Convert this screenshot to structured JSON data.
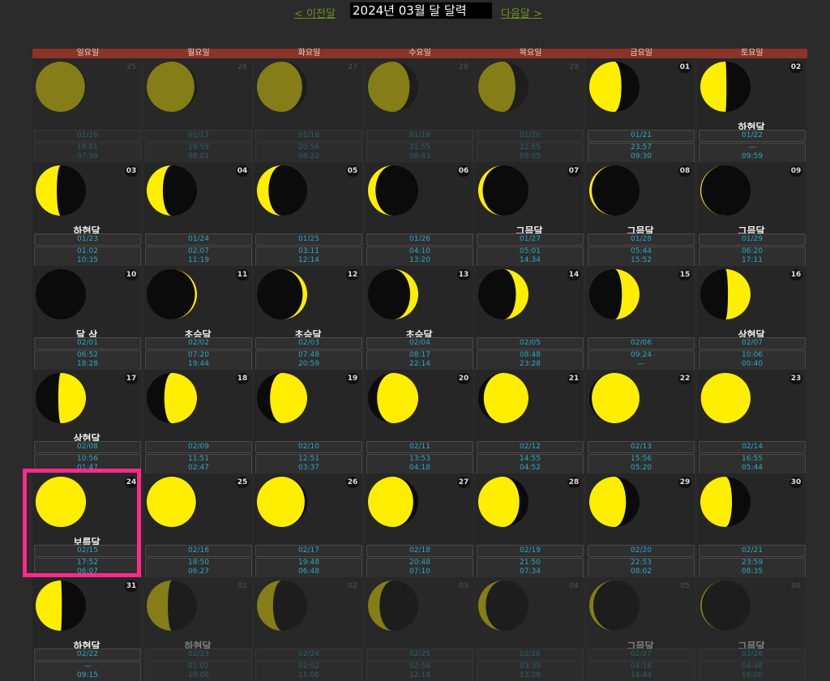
{
  "nav": {
    "prev_label": "< 이전달",
    "next_label": "다음달 >",
    "title": "2024년 03월 달 달력"
  },
  "weekdays": [
    "일요일",
    "월요일",
    "화요일",
    "수요일",
    "목요일",
    "금요일",
    "토요일"
  ],
  "colors": {
    "moon_lit": "#ffee00",
    "moon_dark": "#0b0b0b",
    "header_bg": "#8a3328",
    "accent_text": "#2da7c4",
    "highlight_border": "#ff2a8a"
  },
  "cells": [
    {
      "day": "25",
      "current": false,
      "phase": "",
      "lunar": "01/16",
      "rise": "19:01",
      "set": "07:39",
      "illum": 0.98,
      "waxing": false
    },
    {
      "day": "26",
      "current": false,
      "phase": "",
      "lunar": "01/17",
      "rise": "19:59",
      "set": "08:01",
      "illum": 0.95,
      "waxing": false
    },
    {
      "day": "27",
      "current": false,
      "phase": "",
      "lunar": "01/18",
      "rise": "20:56",
      "set": "08:22",
      "illum": 0.9,
      "waxing": false
    },
    {
      "day": "28",
      "current": false,
      "phase": "",
      "lunar": "01/19",
      "rise": "21:55",
      "set": "08:43",
      "illum": 0.83,
      "waxing": false
    },
    {
      "day": "29",
      "current": false,
      "phase": "",
      "lunar": "01/20",
      "rise": "22:55",
      "set": "09:05",
      "illum": 0.74,
      "waxing": false
    },
    {
      "day": "01",
      "current": true,
      "phase": "",
      "lunar": "01/21",
      "rise": "23:57",
      "set": "09:30",
      "illum": 0.64,
      "waxing": false
    },
    {
      "day": "02",
      "current": true,
      "phase": "하현달",
      "lunar": "01/22",
      "rise": "—",
      "set": "09:59",
      "illum": 0.52,
      "waxing": false
    },
    {
      "day": "03",
      "current": true,
      "phase": "하현달",
      "lunar": "01/23",
      "rise": "01:02",
      "set": "10:35",
      "illum": 0.42,
      "waxing": false
    },
    {
      "day": "04",
      "current": true,
      "phase": "",
      "lunar": "01/24",
      "rise": "02:07",
      "set": "11:19",
      "illum": 0.32,
      "waxing": false
    },
    {
      "day": "05",
      "current": true,
      "phase": "",
      "lunar": "01/25",
      "rise": "03:11",
      "set": "12:14",
      "illum": 0.23,
      "waxing": false
    },
    {
      "day": "06",
      "current": true,
      "phase": "",
      "lunar": "01/26",
      "rise": "04:10",
      "set": "13:20",
      "illum": 0.15,
      "waxing": false
    },
    {
      "day": "07",
      "current": true,
      "phase": "그믐달",
      "lunar": "01/27",
      "rise": "05:01",
      "set": "14:34",
      "illum": 0.09,
      "waxing": false
    },
    {
      "day": "08",
      "current": true,
      "phase": "그믐달",
      "lunar": "01/28",
      "rise": "05:44",
      "set": "15:52",
      "illum": 0.05,
      "waxing": false
    },
    {
      "day": "09",
      "current": true,
      "phase": "그믐달",
      "lunar": "01/29",
      "rise": "06:20",
      "set": "17:11",
      "illum": 0.02,
      "waxing": false
    },
    {
      "day": "10",
      "current": true,
      "phase": "달 삭",
      "lunar": "02/01",
      "rise": "06:52",
      "set": "18:28",
      "illum": 0.0,
      "waxing": true
    },
    {
      "day": "11",
      "current": true,
      "phase": "초승달",
      "lunar": "02/02",
      "rise": "07:20",
      "set": "19:44",
      "illum": 0.04,
      "waxing": true
    },
    {
      "day": "12",
      "current": true,
      "phase": "초승달",
      "lunar": "02/03",
      "rise": "07:48",
      "set": "20:59",
      "illum": 0.09,
      "waxing": true
    },
    {
      "day": "13",
      "current": true,
      "phase": "초승달",
      "lunar": "02/04",
      "rise": "08:17",
      "set": "22:14",
      "illum": 0.16,
      "waxing": true
    },
    {
      "day": "14",
      "current": true,
      "phase": "",
      "lunar": "02/05",
      "rise": "08:48",
      "set": "23:28",
      "illum": 0.25,
      "waxing": true
    },
    {
      "day": "15",
      "current": true,
      "phase": "",
      "lunar": "02/06",
      "rise": "09:24",
      "set": "—",
      "illum": 0.35,
      "waxing": true
    },
    {
      "day": "16",
      "current": true,
      "phase": "상현달",
      "lunar": "02/07",
      "rise": "10:06",
      "set": "00:40",
      "illum": 0.45,
      "waxing": true
    },
    {
      "day": "17",
      "current": true,
      "phase": "상현달",
      "lunar": "02/08",
      "rise": "10:56",
      "set": "01:47",
      "illum": 0.55,
      "waxing": true
    },
    {
      "day": "18",
      "current": true,
      "phase": "",
      "lunar": "02/09",
      "rise": "11:51",
      "set": "02:47",
      "illum": 0.65,
      "waxing": true
    },
    {
      "day": "19",
      "current": true,
      "phase": "",
      "lunar": "02/10",
      "rise": "12:51",
      "set": "03:37",
      "illum": 0.74,
      "waxing": true
    },
    {
      "day": "20",
      "current": true,
      "phase": "",
      "lunar": "02/11",
      "rise": "13:53",
      "set": "04:18",
      "illum": 0.82,
      "waxing": true
    },
    {
      "day": "21",
      "current": true,
      "phase": "",
      "lunar": "02/12",
      "rise": "14:55",
      "set": "04:52",
      "illum": 0.89,
      "waxing": true
    },
    {
      "day": "22",
      "current": true,
      "phase": "",
      "lunar": "02/13",
      "rise": "15:56",
      "set": "05:20",
      "illum": 0.95,
      "waxing": true
    },
    {
      "day": "23",
      "current": true,
      "phase": "",
      "lunar": "02/14",
      "rise": "16:55",
      "set": "05:44",
      "illum": 0.99,
      "waxing": true
    },
    {
      "day": "24",
      "current": true,
      "phase": "보름달",
      "lunar": "02/15",
      "rise": "17:52",
      "set": "06:07",
      "illum": 1.0,
      "waxing": true
    },
    {
      "day": "25",
      "current": true,
      "phase": "",
      "lunar": "02/16",
      "rise": "18:50",
      "set": "06:27",
      "illum": 0.98,
      "waxing": false
    },
    {
      "day": "26",
      "current": true,
      "phase": "",
      "lunar": "02/17",
      "rise": "19:48",
      "set": "06:48",
      "illum": 0.95,
      "waxing": false
    },
    {
      "day": "27",
      "current": true,
      "phase": "",
      "lunar": "02/18",
      "rise": "20:48",
      "set": "07:10",
      "illum": 0.9,
      "waxing": false
    },
    {
      "day": "28",
      "current": true,
      "phase": "",
      "lunar": "02/19",
      "rise": "21:50",
      "set": "07:34",
      "illum": 0.82,
      "waxing": false
    },
    {
      "day": "29",
      "current": true,
      "phase": "",
      "lunar": "02/20",
      "rise": "22:53",
      "set": "08:02",
      "illum": 0.73,
      "waxing": false
    },
    {
      "day": "30",
      "current": true,
      "phase": "",
      "lunar": "02/21",
      "rise": "23:59",
      "set": "08:35",
      "illum": 0.63,
      "waxing": false
    },
    {
      "day": "31",
      "current": true,
      "phase": "하현달",
      "lunar": "02/22",
      "rise": "—",
      "set": "09:15",
      "illum": 0.52,
      "waxing": false
    },
    {
      "day": "01",
      "current": false,
      "phase": "하현달",
      "lunar": "02/23",
      "rise": "01:02",
      "set": "10:06",
      "illum": 0.42,
      "waxing": false
    },
    {
      "day": "02",
      "current": false,
      "phase": "",
      "lunar": "02/24",
      "rise": "02:02",
      "set": "11:06",
      "illum": 0.32,
      "waxing": false
    },
    {
      "day": "03",
      "current": false,
      "phase": "",
      "lunar": "02/25",
      "rise": "02:54",
      "set": "12:14",
      "illum": 0.23,
      "waxing": false
    },
    {
      "day": "04",
      "current": false,
      "phase": "",
      "lunar": "02/26",
      "rise": "03:39",
      "set": "13:28",
      "illum": 0.15,
      "waxing": false
    },
    {
      "day": "05",
      "current": false,
      "phase": "그믐달",
      "lunar": "02/27",
      "rise": "04:16",
      "set": "14:44",
      "illum": 0.08,
      "waxing": false
    },
    {
      "day": "06",
      "current": false,
      "phase": "그믐달",
      "lunar": "02/28",
      "rise": "04:48",
      "set": "16:00",
      "illum": 0.03,
      "waxing": false
    }
  ]
}
